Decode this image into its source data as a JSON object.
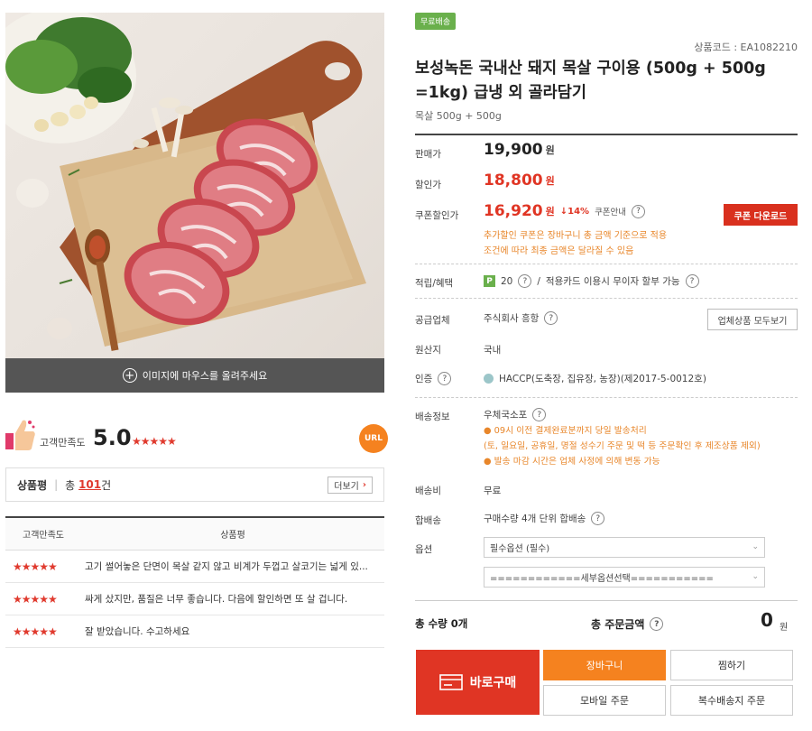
{
  "left": {
    "hover_hint": "이미지에 마우스를 올려주세요",
    "satisfaction": {
      "label": "고객만족도",
      "score": "5.0",
      "stars": "★★★★★"
    },
    "url_label": "URL",
    "review_header": {
      "title": "상품평",
      "total_prefix": "총",
      "count": "101",
      "count_suffix": "건",
      "more_label": "더보기"
    },
    "review_table": {
      "col1": "고객만족도",
      "col2": "상품평",
      "rows": [
        {
          "stars": "★★★★★",
          "text": "고기 썰어놓은 단면이 목살 같지 않고 비계가 두껍고 살코기는 넓게 있..."
        },
        {
          "stars": "★★★★★",
          "text": "싸게 샀지만, 품질은 너무 좋습니다. 다음에 할인하면 또 살 겁니다."
        },
        {
          "stars": "★★★★★",
          "text": "잘 받았습니다. 수고하세요"
        }
      ]
    }
  },
  "right": {
    "badge": "무료배송",
    "product_code": "상품코드 : EA1082210",
    "title": "보성녹돈 국내산 돼지 목살 구이용 (500g + 500g =1kg) 급냉 외 골라담기",
    "subtitle": "목살 500g + 500g",
    "sale_price": {
      "label": "판매가",
      "value": "19,900",
      "unit": "원"
    },
    "discount_price": {
      "label": "할인가",
      "value": "18,800",
      "unit": "원"
    },
    "coupon_price": {
      "label": "쿠폰할인가",
      "value": "16,920",
      "unit": "원",
      "rate": "↓14%",
      "guide": "쿠폰안내",
      "button": "쿠폰 다운로드"
    },
    "coupon_notes": [
      "추가할인 쿠폰은 장바구니 총 금액 기준으로 적용",
      "조건에 따라 최종 금액은 달라질 수 있음"
    ],
    "points": {
      "label": "적립/혜택",
      "icon": "P",
      "value": "20",
      "sep": "/",
      "card": "적용카드 이용시 무이자 할부 가능"
    },
    "supplier": {
      "label": "공급업체",
      "value": "주식회사 흥항",
      "button": "업체상품 모두보기"
    },
    "origin": {
      "label": "원산지",
      "value": "국내"
    },
    "cert": {
      "label": "인증",
      "value": "HACCP(도축장, 집유장, 농장)(제2017-5-0012호)"
    },
    "shipping": {
      "label": "배송정보",
      "value": "우체국소포",
      "notes": [
        "● 09시 이전 결제완료분까지 당일 발송처리",
        "(토, 일요일, 공휴일, 명절 성수기 주문 및 떡 등 주문확인 후 제조상품 제외)",
        "● 발송 마감 시간은 업체 사정에 의해 변동 가능"
      ]
    },
    "shipping_fee": {
      "label": "배송비",
      "value": "무료"
    },
    "bundle": {
      "label": "합배송",
      "value": "구매수량 4개 단위 합배송"
    },
    "options": {
      "label": "옵션",
      "select1": "필수옵션 (필수)",
      "select2": "============세부옵션선택==========="
    },
    "total": {
      "qty_label": "총 수량",
      "qty_value": "0개",
      "amount_label": "총 주문금액",
      "amount": "0",
      "unit": "원"
    },
    "buttons": {
      "buy": "바로구매",
      "cart": "장바구니",
      "wish": "찜하기",
      "mobile": "모바일 주문",
      "multi": "복수배송지 주문"
    }
  },
  "colors": {
    "accent_red": "#e03524",
    "orange": "#f5821f",
    "note_orange": "#e8862a",
    "green": "#6ab04c",
    "star_red": "#e03a2e"
  }
}
